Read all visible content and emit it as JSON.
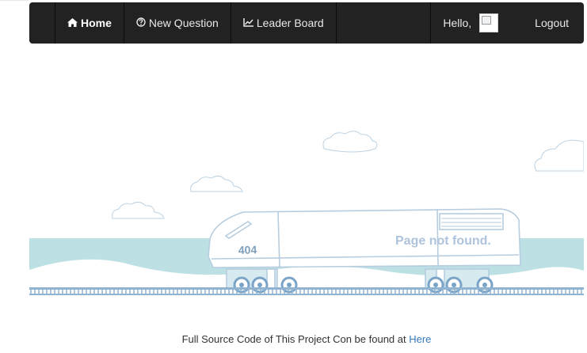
{
  "navbar": {
    "items": [
      {
        "label": "Home",
        "icon": "home-icon",
        "active": true
      },
      {
        "label": "New Question",
        "icon": "question-circle-icon",
        "active": false
      },
      {
        "label": "Leader Board",
        "icon": "line-chart-icon",
        "active": false
      }
    ],
    "greeting": "Hello,",
    "logout_label": "Logout"
  },
  "illustration": {
    "train_number": "404",
    "message": "Page not found."
  },
  "footer": {
    "text": "Full Source Code of This Project Con be found at",
    "link_label": "Here"
  },
  "colors": {
    "navbar_bg": "#222222",
    "sea": "#bde0e5",
    "line": "#bcd2e2",
    "link": "#3779bd"
  }
}
